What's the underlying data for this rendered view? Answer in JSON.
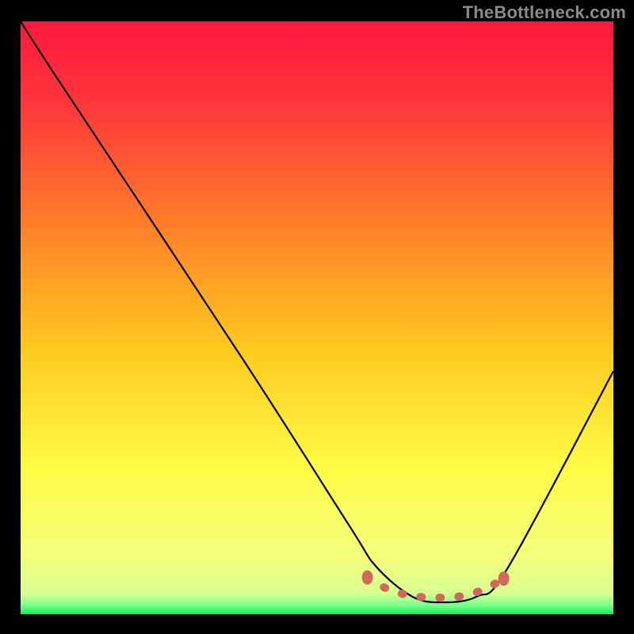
{
  "watermark": "TheBottleneck.com",
  "chart_data": {
    "type": "line",
    "title": "",
    "xlabel": "",
    "ylabel": "",
    "xlim": [
      0,
      100
    ],
    "ylim": [
      0,
      100
    ],
    "series": [
      {
        "name": "curve",
        "x": [
          0,
          7.1,
          37.5,
          55.4,
          60,
          66,
          71,
          77,
          82.3,
          100
        ],
        "values": [
          100,
          89,
          43,
          15,
          8,
          3,
          2,
          3,
          8,
          41
        ]
      }
    ],
    "highlight": {
      "name": "optimal-zone",
      "x": [
        58.5,
        62,
        66,
        70,
        74,
        78,
        81.5
      ],
      "values": [
        6.2,
        4.2,
        3.1,
        2.8,
        3.0,
        4.1,
        6.0
      ]
    },
    "gradient_stops": [
      {
        "offset": 0.0,
        "color": "#ff183f"
      },
      {
        "offset": 0.15,
        "color": "#ff3a3a"
      },
      {
        "offset": 0.33,
        "color": "#ff7a2a"
      },
      {
        "offset": 0.55,
        "color": "#ffc81f"
      },
      {
        "offset": 0.75,
        "color": "#fffb45"
      },
      {
        "offset": 0.9,
        "color": "#f4ff7a"
      },
      {
        "offset": 0.965,
        "color": "#d8ff90"
      },
      {
        "offset": 0.985,
        "color": "#7cff8c"
      },
      {
        "offset": 1.0,
        "color": "#18e860"
      }
    ]
  }
}
